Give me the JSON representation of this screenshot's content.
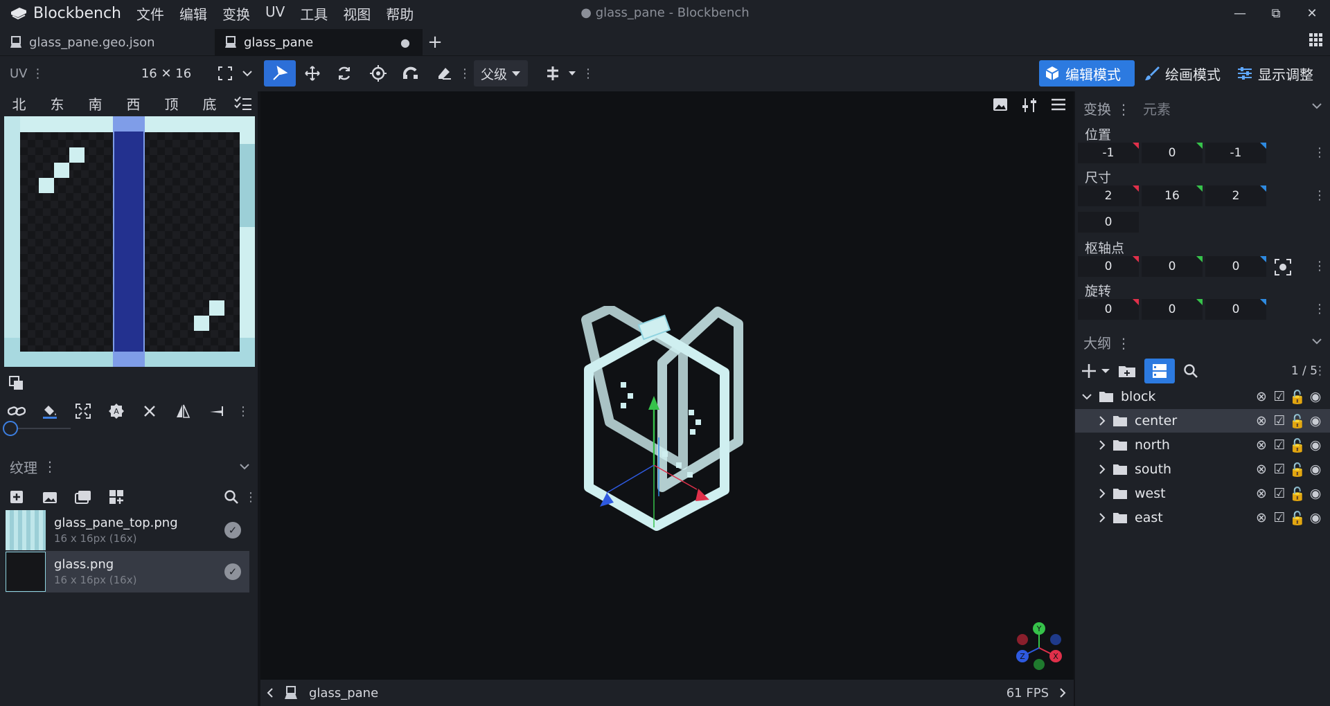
{
  "app": {
    "name": "Blockbench",
    "window_title": "● glass_pane - Blockbench",
    "menu": [
      "文件",
      "编辑",
      "变换",
      "UV",
      "工具",
      "视图",
      "帮助"
    ]
  },
  "tabs": [
    {
      "label": "glass_pane.geo.json",
      "ext": ".json",
      "base": "glass_pane.geo"
    },
    {
      "label": "glass_pane",
      "modified": "●"
    }
  ],
  "toolbar": {
    "uv_label": "UV",
    "uv_size": "16 ✕ 16",
    "parent_select": "父级",
    "modes": {
      "edit": "编辑模式",
      "paint": "绘画模式",
      "display": "显示调整"
    }
  },
  "uv_panel": {
    "faces": [
      "北",
      "东",
      "南",
      "西",
      "顶",
      "底"
    ]
  },
  "textures": {
    "header": "纹理",
    "items": [
      {
        "name": "glass_pane_top.png",
        "info": "16 x 16px (16x)"
      },
      {
        "name": "glass.png",
        "info": "16 x 16px (16x)"
      }
    ]
  },
  "element_panel": {
    "tab_transform": "变换",
    "tab_element": "元素",
    "position_label": "位置",
    "position": [
      "-1",
      "0",
      "-1"
    ],
    "size_label": "尺寸",
    "size": [
      "2",
      "16",
      "2"
    ],
    "inflate": "0",
    "pivot_label": "枢轴点",
    "pivot": [
      "0",
      "0",
      "0"
    ],
    "rotation_label": "旋转",
    "rotation": [
      "0",
      "0",
      "0"
    ]
  },
  "outliner": {
    "header": "大纲",
    "count": "1 / 5",
    "root": "block",
    "children": [
      "center",
      "north",
      "south",
      "west",
      "east"
    ]
  },
  "viewport": {
    "model_name": "glass_pane",
    "fps": "61 FPS",
    "gizmo_axes": {
      "x": "X",
      "y": "Y",
      "z": "Z"
    }
  },
  "colors": {
    "accent": "#2c7ae0",
    "glass": "#cfeff0",
    "axis_x": "#e0304a",
    "axis_y": "#36c24a",
    "axis_z": "#2e5ae0"
  }
}
